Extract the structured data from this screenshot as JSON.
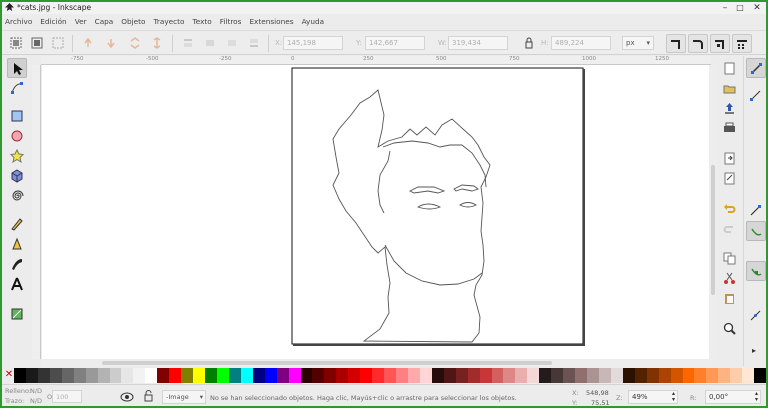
{
  "window": {
    "title": "*cats.jpg - Inkscape",
    "minimize": "–",
    "maximize": "□",
    "close": "✕"
  },
  "menu": [
    "Archivo",
    "Edición",
    "Ver",
    "Capa",
    "Objeto",
    "Trayecto",
    "Texto",
    "Filtros",
    "Extensiones",
    "Ayuda"
  ],
  "toolbar": {
    "x_label": "X:",
    "x_value": "145,198",
    "y_label": "Y:",
    "y_value": "142,667",
    "w_label": "W:",
    "w_value": "319,434",
    "h_label": "H:",
    "h_value": "489,224",
    "unit": "px"
  },
  "ruler": {
    "labels": [
      "-750",
      "-500",
      "-250",
      "0",
      "250",
      "500",
      "750",
      "1000",
      "1250"
    ]
  },
  "palette_colors": [
    "#000000",
    "#1a1a1a",
    "#333333",
    "#4d4d4d",
    "#666666",
    "#808080",
    "#999999",
    "#b3b3b3",
    "#cccccc",
    "#e6e6e6",
    "#f2f2f2",
    "#ffffff",
    "#800000",
    "#ff0000",
    "#808000",
    "#ffff00",
    "#008000",
    "#00ff00",
    "#008080",
    "#00ffff",
    "#000080",
    "#0000ff",
    "#800080",
    "#ff00ff",
    "#2b0000",
    "#550000",
    "#800000",
    "#aa0000",
    "#d40000",
    "#ff0000",
    "#ff2a2a",
    "#ff5555",
    "#ff8080",
    "#ffaaaa",
    "#ffd5d5",
    "#280b0b",
    "#501616",
    "#782121",
    "#a02c2c",
    "#c83737",
    "#d35f5f",
    "#de8787",
    "#e9afaf",
    "#f4d7d7",
    "#241c1c",
    "#483737",
    "#6c5353",
    "#916f6f",
    "#ac9393",
    "#c8b7b7",
    "#e3dbdb",
    "#2b1100",
    "#552200",
    "#803300",
    "#aa4400",
    "#d45500",
    "#ff6600",
    "#ff7f2a",
    "#ff9955",
    "#ffb380",
    "#ffccaa",
    "#ffe6d5",
    "#000000"
  ],
  "status": {
    "fill_label": "Relleno:",
    "fill_value": "N/D",
    "stroke_label": "Trazo:",
    "stroke_value": "N/D",
    "opacity_label": "O:",
    "opacity_value": "100",
    "layer": "-Image",
    "message": "No se han seleccionado objetos. Haga clic, Mayús+clic o arrastre para seleccionar los objetos.",
    "x_label": "X:",
    "x_value": "548,98",
    "y_label": "Y:",
    "y_value": "75,51",
    "zoom_label": "Z:",
    "zoom_value": "49%",
    "rot_label": "R:",
    "rot_value": "0,00°"
  }
}
